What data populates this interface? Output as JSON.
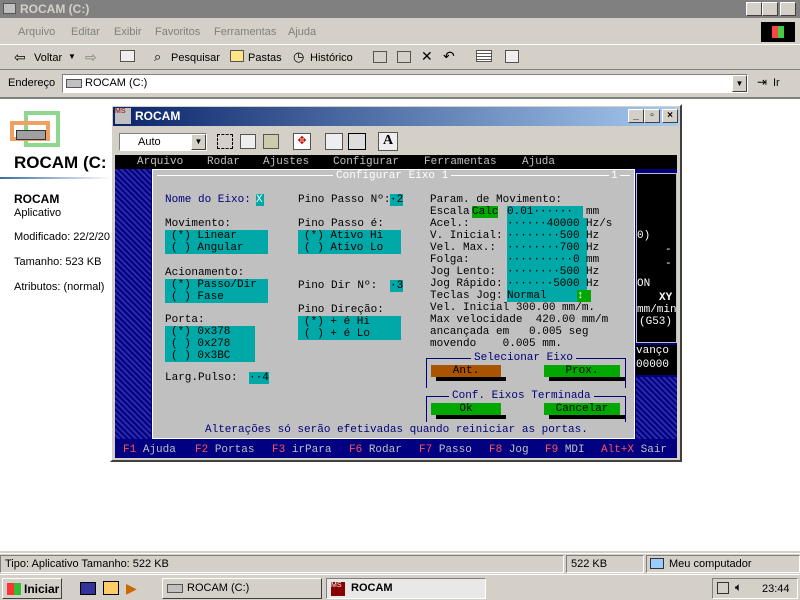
{
  "explorer": {
    "title": "ROCAM (C:)",
    "menu": [
      "Arquivo",
      "Editar",
      "Exibir",
      "Favoritos",
      "Ferramentas",
      "Ajuda"
    ],
    "toolbar": {
      "back": "Voltar",
      "search": "Pesquisar",
      "folders": "Pastas",
      "history": "Histórico"
    },
    "address_label": "Endereço",
    "address_value": "ROCAM (C:)",
    "go": "Ir",
    "left_title": "ROCAM (C:",
    "item_name": "ROCAM",
    "item_type": "Aplicativo",
    "modified": "Modificado: 22/2/20",
    "size": "Tamanho: 523 KB",
    "attributes": "Atributos: (normal)",
    "status_left": "Tipo: Aplicativo Tamanho: 522 KB",
    "status_size": "522 KB",
    "status_zone": "Meu computador"
  },
  "dos": {
    "title": "ROCAM",
    "font_select": "Auto",
    "menu": [
      "Arquivo",
      "Rodar",
      "Ajustes",
      "Configurar",
      "Ferramentas",
      "Ajuda"
    ],
    "dialog_title": "Configurar Eixo 1",
    "dialog_marker": "1",
    "nome_label": "Nome do Eixo:",
    "nome_value": "X",
    "movimento_label": "Movimento:",
    "movimento_opts": [
      "(*) Linear",
      "( ) Angular"
    ],
    "acionamento_label": "Acionamento:",
    "acionamento_opts": [
      "(*) Passo/Dir",
      "( ) Fase"
    ],
    "porta_label": "Porta:",
    "porta_opts": [
      "(*) 0x378",
      "( ) 0x278",
      "( ) 0x3BC"
    ],
    "larg_label": "Larg.Pulso:",
    "larg_value": "··4",
    "pino_passo_no_label": "Pino Passo Nº:",
    "pino_passo_no_value": "·2",
    "pino_passo_e_label": "Pino Passo é:",
    "pino_passo_e_opts": [
      "(*) Ativo Hi",
      "( ) Ativo Lo"
    ],
    "pino_dir_label": "Pino Dir Nº:",
    "pino_dir_value": "·3",
    "pino_direcao_label": "Pino Direção:",
    "pino_direcao_opts": [
      "(*) + é Hi",
      "( ) + é Lo"
    ],
    "param_label": "Param. de Movimento:",
    "escala_label": "Escala",
    "escala_calc": "Calc",
    "escala_value": "0.01······",
    "escala_unit": "mm",
    "params": [
      {
        "label": "Acel.:",
        "value": "······40000",
        "unit": "Hz/s"
      },
      {
        "label": "V. Inicial:",
        "value": "········500",
        "unit": "Hz"
      },
      {
        "label": "Vel. Max.:",
        "value": "········700",
        "unit": "Hz"
      },
      {
        "label": "Folga:",
        "value": "··········0",
        "unit": "mm"
      },
      {
        "label": "Jog Lento:",
        "value": "········500",
        "unit": "Hz"
      },
      {
        "label": "Jog Rápido:",
        "value": "·······5000",
        "unit": "Hz"
      }
    ],
    "teclas_label": "Teclas Jog:",
    "teclas_value": "Normal",
    "teclas_arrow": "↕",
    "info": [
      "Vel. Inicial 300.00 mm/m.",
      "Max velocidade  420.00 mm/m",
      "ancançada em   0.005 seg",
      "movendo    0.005 mm."
    ],
    "sel_eixo": "Selecionar Eixo",
    "ant": "Ant.",
    "prox": "Prox.",
    "conf_label": "Conf. Eixos Terminada",
    "ok": "Ok",
    "cancelar": "Cancelar",
    "warning": "Alterações só serão efetivadas quando reiniciar as portas.",
    "right_panel": [
      "XY",
      "mm/min",
      "(G53)",
      "vanço",
      "00000",
      "ON",
      "0)"
    ],
    "fkeys": [
      {
        "k": "F1",
        "l": "Ajuda"
      },
      {
        "k": "F2",
        "l": "Portas"
      },
      {
        "k": "F3",
        "l": "irPara"
      },
      {
        "k": "F6",
        "l": "Rodar"
      },
      {
        "k": "F7",
        "l": "Passo"
      },
      {
        "k": "F8",
        "l": "Jog"
      },
      {
        "k": "F9",
        "l": "MDI"
      },
      {
        "k": "Alt+X",
        "l": "Sair"
      }
    ]
  },
  "taskbar": {
    "start": "Iniciar",
    "task1": "ROCAM (C:)",
    "task2": "ROCAM",
    "clock": "23:44"
  }
}
